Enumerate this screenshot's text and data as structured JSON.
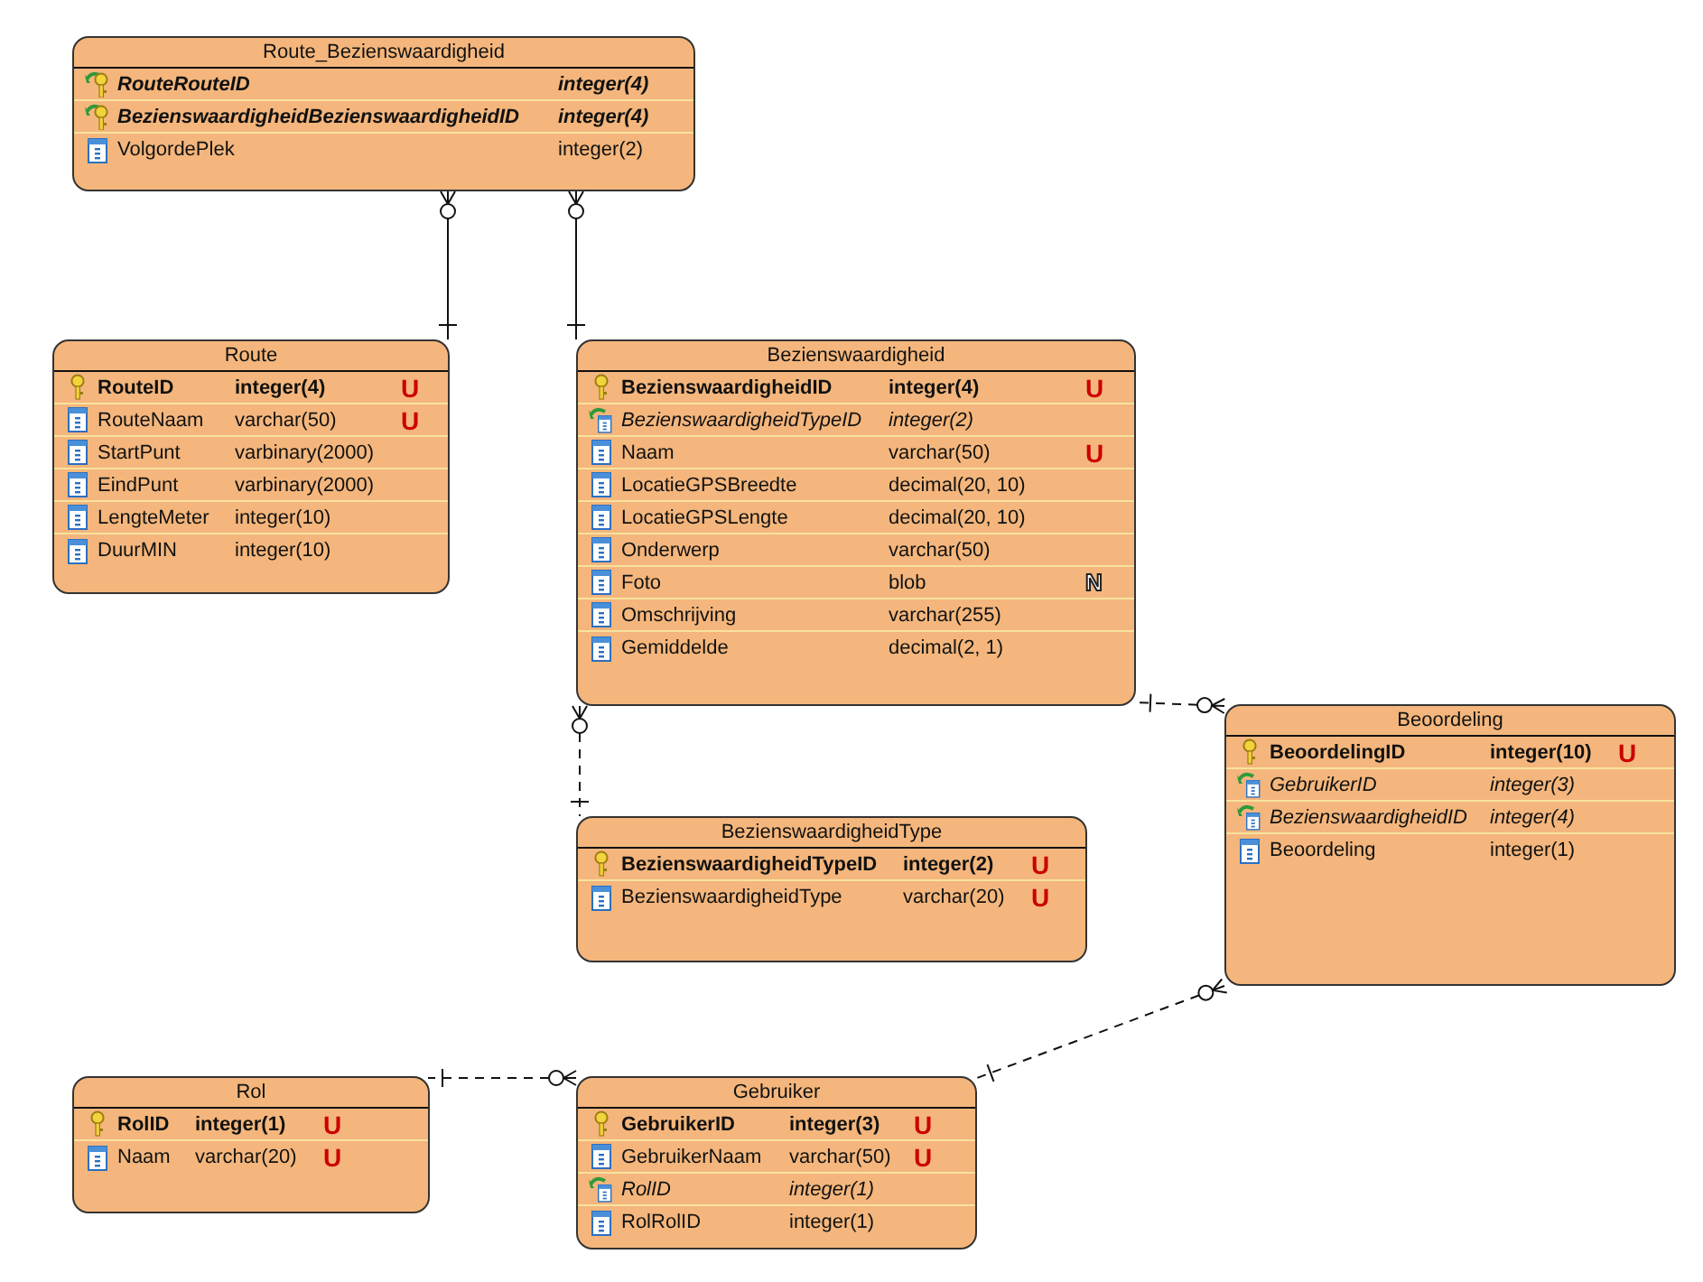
{
  "entities": [
    {
      "title": "Route_Bezienswaardigheid",
      "columns": [
        {
          "name": "RouteRouteID",
          "type": "integer(4)",
          "kind": "pfk"
        },
        {
          "name": "BezienswaardigheidBezienswaardigheidID",
          "type": "integer(4)",
          "kind": "pfk"
        },
        {
          "name": "VolgordePlek",
          "type": "integer(2)",
          "kind": "column"
        }
      ]
    },
    {
      "title": "Route",
      "columns": [
        {
          "name": "RouteID",
          "type": "integer(4)",
          "kind": "pk",
          "constraint": {
            "kind": "unique",
            "label": "U"
          }
        },
        {
          "name": "RouteNaam",
          "type": "varchar(50)",
          "kind": "column",
          "constraint": {
            "kind": "unique",
            "label": "U"
          }
        },
        {
          "name": "StartPunt",
          "type": "varbinary(2000)",
          "kind": "column"
        },
        {
          "name": "EindPunt",
          "type": "varbinary(2000)",
          "kind": "column"
        },
        {
          "name": "LengteMeter",
          "type": "integer(10)",
          "kind": "column"
        },
        {
          "name": "DuurMIN",
          "type": "integer(10)",
          "kind": "column"
        }
      ]
    },
    {
      "title": "Bezienswaardigheid",
      "columns": [
        {
          "name": "BezienswaardigheidID",
          "type": "integer(4)",
          "kind": "pk",
          "constraint": {
            "kind": "unique",
            "label": "U"
          }
        },
        {
          "name": "BezienswaardigheidTypeID",
          "type": "integer(2)",
          "kind": "fk"
        },
        {
          "name": "Naam",
          "type": "varchar(50)",
          "kind": "column",
          "constraint": {
            "kind": "unique",
            "label": "U"
          }
        },
        {
          "name": "LocatieGPSBreedte",
          "type": "decimal(20, 10)",
          "kind": "column"
        },
        {
          "name": "LocatieGPSLengte",
          "type": "decimal(20, 10)",
          "kind": "column"
        },
        {
          "name": "Onderwerp",
          "type": "varchar(50)",
          "kind": "column"
        },
        {
          "name": "Foto",
          "type": "blob",
          "kind": "column",
          "constraint": {
            "kind": "nullable",
            "label": "N"
          }
        },
        {
          "name": "Omschrijving",
          "type": "varchar(255)",
          "kind": "column"
        },
        {
          "name": "Gemiddelde",
          "type": "decimal(2, 1)",
          "kind": "column"
        }
      ]
    },
    {
      "title": "Beoordeling",
      "columns": [
        {
          "name": "BeoordelingID",
          "type": "integer(10)",
          "kind": "pk",
          "constraint": {
            "kind": "unique",
            "label": "U"
          }
        },
        {
          "name": "GebruikerID",
          "type": "integer(3)",
          "kind": "fk"
        },
        {
          "name": "BezienswaardigheidID",
          "type": "integer(4)",
          "kind": "fk"
        },
        {
          "name": "Beoordeling",
          "type": "integer(1)",
          "kind": "column"
        }
      ]
    },
    {
      "title": "BezienswaardigheidType",
      "columns": [
        {
          "name": "BezienswaardigheidTypeID",
          "type": "integer(2)",
          "kind": "pk",
          "constraint": {
            "kind": "unique",
            "label": "U"
          }
        },
        {
          "name": "BezienswaardigheidType",
          "type": "varchar(20)",
          "kind": "column",
          "constraint": {
            "kind": "unique",
            "label": "U"
          }
        }
      ]
    },
    {
      "title": "Rol",
      "columns": [
        {
          "name": "RolID",
          "type": "integer(1)",
          "kind": "pk",
          "constraint": {
            "kind": "unique",
            "label": "U"
          }
        },
        {
          "name": "Naam",
          "type": "varchar(20)",
          "kind": "column",
          "constraint": {
            "kind": "unique",
            "label": "U"
          }
        }
      ]
    },
    {
      "title": "Gebruiker",
      "columns": [
        {
          "name": "GebruikerID",
          "type": "integer(3)",
          "kind": "pk",
          "constraint": {
            "kind": "unique",
            "label": "U"
          }
        },
        {
          "name": "GebruikerNaam",
          "type": "varchar(50)",
          "kind": "column",
          "constraint": {
            "kind": "unique",
            "label": "U"
          }
        },
        {
          "name": "RolID",
          "type": "integer(1)",
          "kind": "fk"
        },
        {
          "name": "RolRolID",
          "type": "integer(1)",
          "kind": "column"
        }
      ]
    }
  ],
  "relationships": [
    {
      "kind": "identifying"
    },
    {
      "kind": "identifying"
    },
    {
      "kind": "non_identifying"
    },
    {
      "kind": "non_identifying"
    },
    {
      "kind": "non_identifying"
    },
    {
      "kind": "non_identifying"
    }
  ]
}
